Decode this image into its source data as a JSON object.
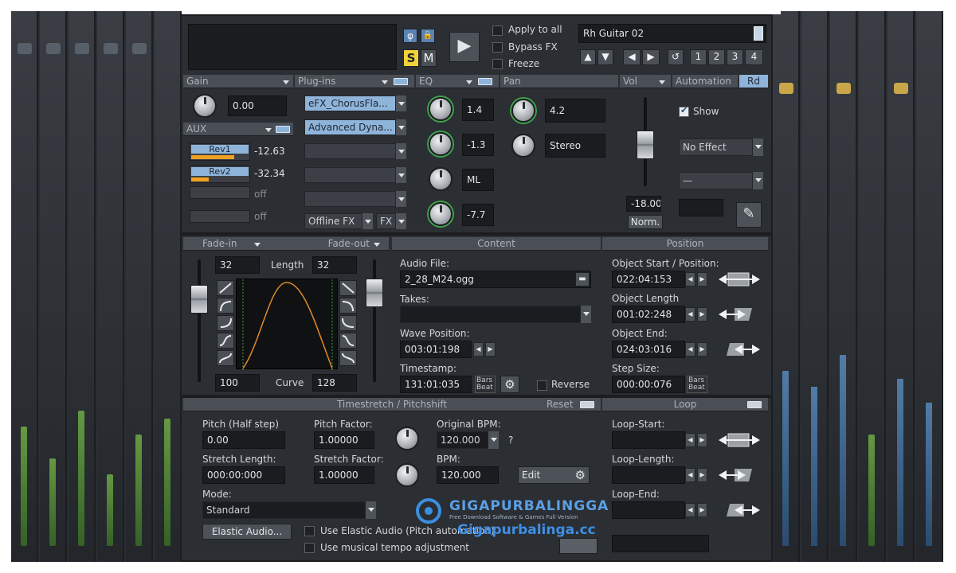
{
  "transport": {
    "phase_label": "φ",
    "lock_label": "🔒",
    "solo_label": "S",
    "mute_label": "M",
    "play_label": "▶",
    "apply_to_all": "Apply to all",
    "bypass_fx": "Bypass FX",
    "freeze": "Freeze",
    "track_name": "Rh Guitar 02",
    "num_buttons": [
      "1",
      "2",
      "3",
      "4"
    ]
  },
  "gain": {
    "header": "Gain",
    "value": "0.00"
  },
  "aux": {
    "header": "AUX",
    "sends": [
      {
        "name": "Rev1",
        "value": "-12.63",
        "level": 0.75
      },
      {
        "name": "Rev2",
        "value": "-32.34",
        "level": 0.3
      },
      {
        "name": "",
        "value": "off",
        "level": 0
      },
      {
        "name": "",
        "value": "off",
        "level": 0
      }
    ]
  },
  "plugins": {
    "header": "Plug-ins",
    "slots": [
      "eFX_ChorusFla...",
      "Advanced Dyna...",
      "",
      "",
      ""
    ],
    "offline_fx": "Offline FX",
    "fx": "FX"
  },
  "eq": {
    "header": "EQ",
    "values": [
      "1.4",
      "-1.3",
      "ML",
      "-7.7"
    ]
  },
  "pan": {
    "header": "Pan",
    "value": "4.2",
    "mode": "Stereo"
  },
  "vol": {
    "header": "Vol",
    "value": "-18.00",
    "norm": "Norm.",
    "level": 0.55
  },
  "automation": {
    "header": "Automation",
    "rd": "Rd",
    "show": "Show",
    "effect": "No Effect",
    "param": "—"
  },
  "fade": {
    "fade_in": "Fade-in",
    "fade_out": "Fade-out",
    "in_value": "32",
    "length_label": "Length",
    "out_value": "32",
    "curve_in": "100",
    "curve_label": "Curve",
    "curve_out": "128"
  },
  "content": {
    "header": "Content",
    "audio_file_label": "Audio File:",
    "audio_file": "2_28_M24.ogg",
    "takes_label": "Takes:",
    "takes": "",
    "wave_position_label": "Wave Position:",
    "wave_position": "003:01:198",
    "timestamp_label": "Timestamp:",
    "timestamp": "131:01:035",
    "bars_label": "Bars",
    "beat_label": "Beat",
    "reverse": "Reverse"
  },
  "position": {
    "header": "Position",
    "start_label": "Object Start / Position:",
    "start": "022:04:153",
    "length_label": "Object Length",
    "length": "001:02:248",
    "end_label": "Object End:",
    "end": "024:03:016",
    "step_label": "Step Size:",
    "step": "000:00:076"
  },
  "timestretch": {
    "header": "Timestretch / Pitchshift",
    "reset": "Reset",
    "pitch_label": "Pitch (Half step)",
    "pitch": "0.00",
    "pitch_factor_label": "Pitch Factor:",
    "pitch_factor": "1.00000",
    "original_bpm_label": "Original BPM:",
    "original_bpm": "120.000",
    "question": "?",
    "stretch_length_label": "Stretch Length:",
    "stretch_length": "000:00:000",
    "stretch_factor_label": "Stretch Factor:",
    "stretch_factor": "1.00000",
    "bpm_label": "BPM:",
    "bpm": "120.000",
    "edit": "Edit",
    "mode_label": "Mode:",
    "mode": "Standard",
    "elastic_audio": "Elastic Audio...",
    "use_elastic": "Use Elastic Audio (Pitch automation)",
    "use_musical": "Use musical tempo adjustment"
  },
  "loop": {
    "header": "Loop",
    "start_label": "Loop-Start:",
    "length_label": "Loop-Length:",
    "end_label": "Loop-End:"
  },
  "watermark": {
    "brand": "GIGAPURBALINGGA",
    "tagline": "Free Download Software & Games Full Version",
    "url": "Gigapurbalinga.cc"
  },
  "colors": {
    "accent": "#8fb4da",
    "meter_orange": "#f0a020",
    "solo_yellow": "#f0d33c",
    "fade_curve": "#e08a2a"
  }
}
